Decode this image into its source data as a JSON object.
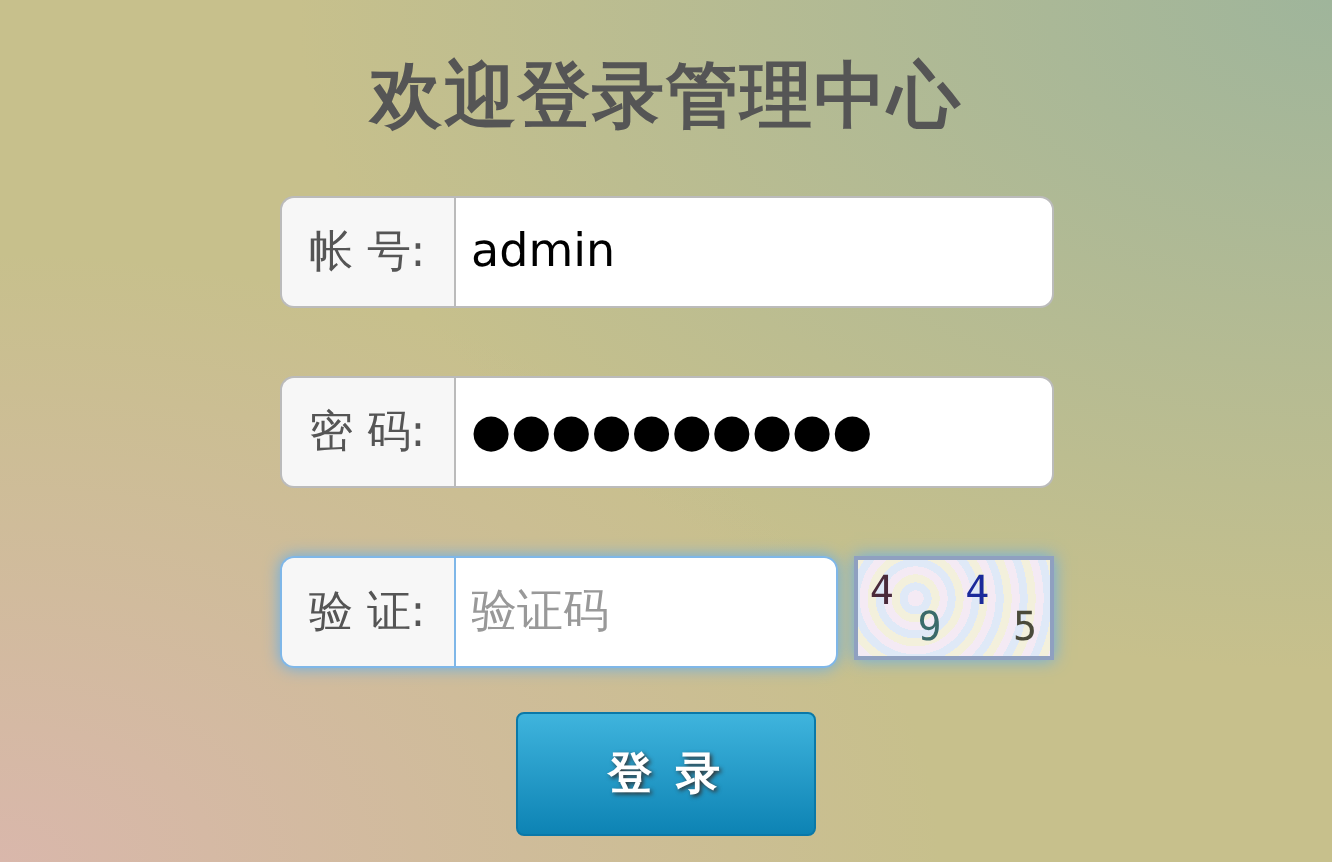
{
  "title": "欢迎登录管理中心",
  "fields": [
    {
      "kind": "text",
      "label": "帐 号:",
      "value": "admin",
      "focused": false
    },
    {
      "kind": "password",
      "label": "密 码:",
      "value": "●●●●●●●●●●",
      "focused": false
    },
    {
      "kind": "captcha",
      "label": "验 证:",
      "placeholder": "验证码",
      "focused": true,
      "captcha_chars": [
        {
          "char": "4",
          "color": "#4a2a3a"
        },
        {
          "char": "9",
          "color": "#3a6a6a"
        },
        {
          "char": "4",
          "color": "#1a2a9a"
        },
        {
          "char": "5",
          "color": "#4a4a3a"
        }
      ]
    }
  ],
  "submit_button": "登 录"
}
